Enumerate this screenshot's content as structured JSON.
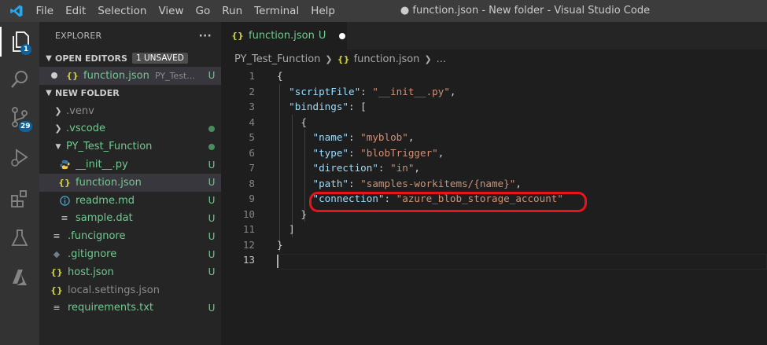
{
  "menu": [
    "File",
    "Edit",
    "Selection",
    "View",
    "Go",
    "Run",
    "Terminal",
    "Help"
  ],
  "window_title": "● function.json - New folder - Visual Studio Code",
  "activity": {
    "explorer_badge": "1",
    "scm_badge": "29"
  },
  "sidebar": {
    "title": "EXPLORER",
    "more": "···",
    "open_editors": {
      "label": "OPEN EDITORS",
      "badge": "1 UNSAVED",
      "items": [
        {
          "name": "function.json",
          "detail": "PY_Test...",
          "status": "U"
        }
      ]
    },
    "folder": {
      "label": "NEW FOLDER",
      "items": [
        {
          "name": ".venv",
          "status": ""
        },
        {
          "name": ".vscode",
          "status": ""
        },
        {
          "name": "PY_Test_Function",
          "status": ""
        },
        {
          "name": "__init__.py",
          "status": "U"
        },
        {
          "name": "function.json",
          "status": "U"
        },
        {
          "name": "readme.md",
          "status": "U"
        },
        {
          "name": "sample.dat",
          "status": "U"
        },
        {
          "name": ".funcignore",
          "status": "U"
        },
        {
          "name": ".gitignore",
          "status": "U"
        },
        {
          "name": "host.json",
          "status": "U"
        },
        {
          "name": "local.settings.json",
          "status": ""
        },
        {
          "name": "requirements.txt",
          "status": "U"
        }
      ]
    }
  },
  "tab": {
    "label": "function.json",
    "status": "U"
  },
  "breadcrumb": {
    "folder": "PY_Test_Function",
    "file": "function.json",
    "more": "..."
  },
  "editor": {
    "line_numbers": [
      "1",
      "2",
      "3",
      "4",
      "5",
      "6",
      "7",
      "8",
      "9",
      "10",
      "11",
      "12",
      "13"
    ],
    "lines": [
      [
        {
          "t": "p",
          "v": "{"
        }
      ],
      [
        {
          "t": "p",
          "v": "  "
        },
        {
          "t": "k",
          "v": "\"scriptFile\""
        },
        {
          "t": "p",
          "v": ": "
        },
        {
          "t": "s",
          "v": "\"__init__.py\""
        },
        {
          "t": "p",
          "v": ","
        }
      ],
      [
        {
          "t": "p",
          "v": "  "
        },
        {
          "t": "k",
          "v": "\"bindings\""
        },
        {
          "t": "p",
          "v": ": ["
        }
      ],
      [
        {
          "t": "p",
          "v": "    {"
        }
      ],
      [
        {
          "t": "p",
          "v": "      "
        },
        {
          "t": "k",
          "v": "\"name\""
        },
        {
          "t": "p",
          "v": ": "
        },
        {
          "t": "s",
          "v": "\"myblob\""
        },
        {
          "t": "p",
          "v": ","
        }
      ],
      [
        {
          "t": "p",
          "v": "      "
        },
        {
          "t": "k",
          "v": "\"type\""
        },
        {
          "t": "p",
          "v": ": "
        },
        {
          "t": "s",
          "v": "\"blobTrigger\""
        },
        {
          "t": "p",
          "v": ","
        }
      ],
      [
        {
          "t": "p",
          "v": "      "
        },
        {
          "t": "k",
          "v": "\"direction\""
        },
        {
          "t": "p",
          "v": ": "
        },
        {
          "t": "s",
          "v": "\"in\""
        },
        {
          "t": "p",
          "v": ","
        }
      ],
      [
        {
          "t": "p",
          "v": "      "
        },
        {
          "t": "k",
          "v": "\"path\""
        },
        {
          "t": "p",
          "v": ": "
        },
        {
          "t": "s",
          "v": "\"samples-workitems/{name}\""
        },
        {
          "t": "p",
          "v": ","
        }
      ],
      [
        {
          "t": "p",
          "v": "      "
        },
        {
          "t": "k",
          "v": "\"connection\""
        },
        {
          "t": "p",
          "v": ": "
        },
        {
          "t": "s",
          "v": "\"azure_blob_storage_account\""
        }
      ],
      [
        {
          "t": "p",
          "v": "    }"
        }
      ],
      [
        {
          "t": "p",
          "v": "  ]"
        }
      ],
      [
        {
          "t": "p",
          "v": "}"
        }
      ],
      [
        {
          "t": "p",
          "v": ""
        }
      ]
    ]
  },
  "colors": {
    "highlight": "#e8131b",
    "accent": "#0e639c",
    "untracked": "#73c991"
  }
}
